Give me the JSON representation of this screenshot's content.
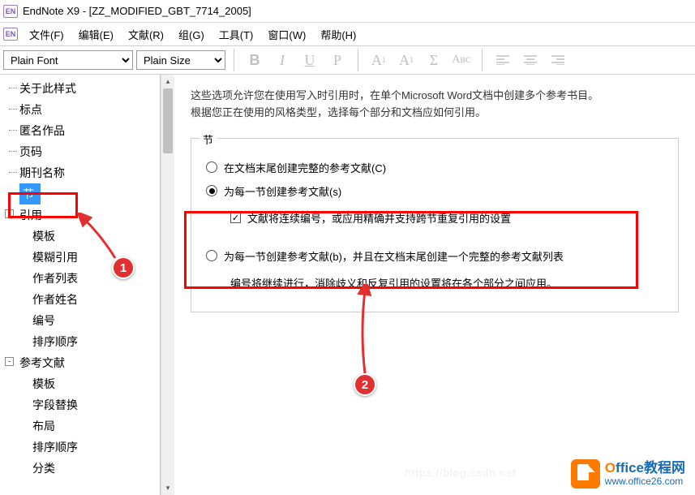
{
  "titlebar": {
    "icon_text": "EN",
    "title": "EndNote X9 - [ZZ_MODIFIED_GBT_7714_2005]"
  },
  "menubar": {
    "items": [
      "文件(F)",
      "编辑(E)",
      "文献(R)",
      "组(G)",
      "工具(T)",
      "窗口(W)",
      "帮助(H)"
    ]
  },
  "toolbar": {
    "font_name": "Plain Font",
    "font_size": "Plain Size"
  },
  "sidebar": {
    "items": [
      {
        "label": "关于此样式",
        "level": 1
      },
      {
        "label": "标点",
        "level": 1
      },
      {
        "label": "匿名作品",
        "level": 1
      },
      {
        "label": "页码",
        "level": 1
      },
      {
        "label": "期刊名称",
        "level": 1
      },
      {
        "label": "节",
        "level": 1,
        "selected": true
      },
      {
        "label": "引用",
        "level": 1,
        "group": true,
        "toggle": "-"
      },
      {
        "label": "模板",
        "level": 2
      },
      {
        "label": "模糊引用",
        "level": 2
      },
      {
        "label": "作者列表",
        "level": 2
      },
      {
        "label": "作者姓名",
        "level": 2
      },
      {
        "label": "编号",
        "level": 2
      },
      {
        "label": "排序顺序",
        "level": 2
      },
      {
        "label": "参考文献",
        "level": 1,
        "group": true,
        "toggle": "-"
      },
      {
        "label": "模板",
        "level": 2
      },
      {
        "label": "字段替换",
        "level": 2
      },
      {
        "label": "布局",
        "level": 2
      },
      {
        "label": "排序顺序",
        "level": 2
      },
      {
        "label": "分类",
        "level": 2
      }
    ]
  },
  "main": {
    "desc_line1": "这些选项允许您在使用写入时引用时，在单个Microsoft Word文档中创建多个参考书目。",
    "desc_line2": "根据您正在使用的风格类型，选择每个部分和文档应如何引用。",
    "fieldset_legend": "节",
    "radio1": "在文档末尾创建完整的参考文献(C)",
    "radio2": "为每一节创建参考文献(s)",
    "checkbox1": "文献将连续编号，或应用精确并支持跨节重复引用的设置",
    "radio3": "为每一节创建参考文献(b)，并且在文档末尾创建一个完整的参考文献列表",
    "note": "编号将继续进行，消除歧义和反复引用的设置将在各个部分之间应用。"
  },
  "annotations": {
    "num1": "1",
    "num2": "2"
  },
  "watermark": {
    "brand_o": "O",
    "brand_rest": "ffice教程网",
    "url": "www.office26.com",
    "faint": "https://blog.csdn.net"
  }
}
